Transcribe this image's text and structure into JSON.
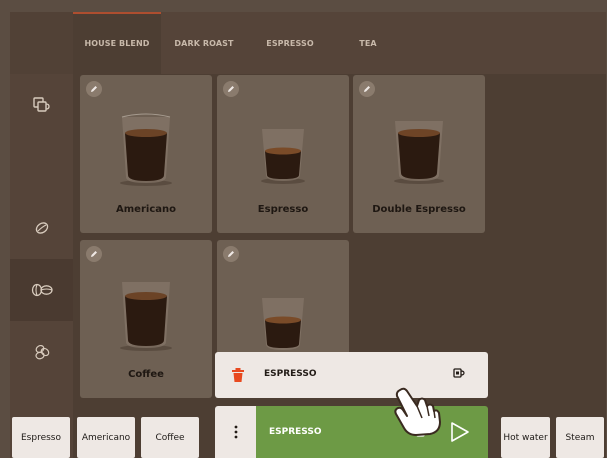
{
  "tabs": [
    {
      "label": "HOUSE BLEND",
      "active": true
    },
    {
      "label": "DARK ROAST",
      "active": false
    },
    {
      "label": "ESPRESSO",
      "active": false
    },
    {
      "label": "TEA",
      "active": false
    }
  ],
  "sidebar": [
    {
      "icon": "cups-icon"
    },
    {
      "icon": "coffee-bean-icon"
    },
    {
      "icon": "coffee-beans-pair-icon",
      "active": true
    },
    {
      "icon": "coffee-beans-cluster-icon"
    }
  ],
  "drinks": [
    {
      "label": "Americano"
    },
    {
      "label": "Espresso"
    },
    {
      "label": "Double Espresso"
    },
    {
      "label": "Coffee"
    },
    {
      "label": ""
    }
  ],
  "panel": {
    "delete_label": "ESPRESSO",
    "active_label": "ESPRESSO",
    "delete_color": "#e8491f",
    "active_color": "#6d9a45"
  },
  "quick": {
    "espresso": "Espresso",
    "americano": "Americano",
    "coffee": "Coffee",
    "hot_water": "Hot water",
    "steam": "Steam"
  }
}
